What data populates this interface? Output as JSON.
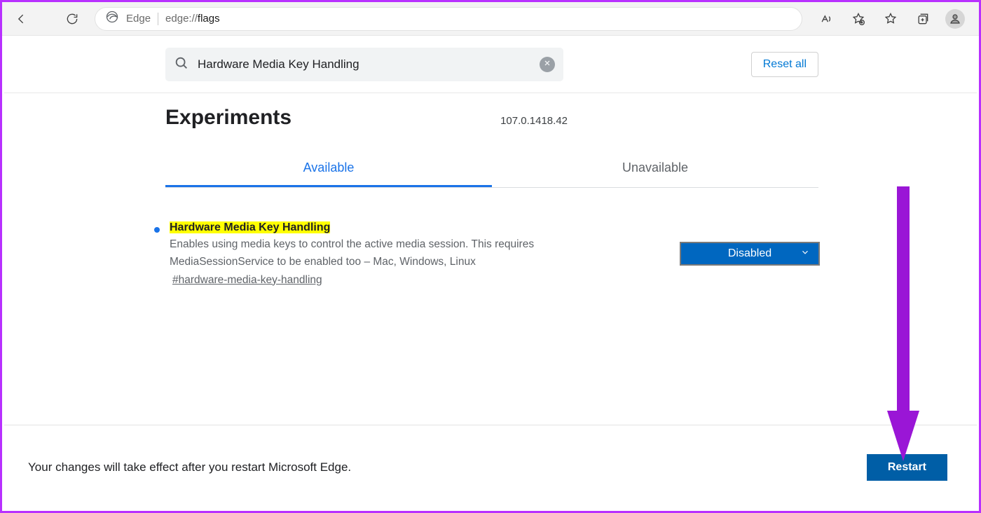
{
  "toolbar": {
    "browser_label": "Edge",
    "url_prefix": "edge://",
    "url_suffix": "flags"
  },
  "search": {
    "value": "Hardware Media Key Handling",
    "reset_label": "Reset all"
  },
  "header": {
    "title": "Experiments",
    "version": "107.0.1418.42"
  },
  "tabs": {
    "available": "Available",
    "unavailable": "Unavailable"
  },
  "flag": {
    "title": "Hardware Media Key Handling",
    "description": "Enables using media keys to control the active media session. This requires MediaSessionService to be enabled too – Mac, Windows, Linux",
    "hash": "#hardware-media-key-handling",
    "select_value": "Disabled"
  },
  "footer": {
    "message": "Your changes will take effect after you restart Microsoft Edge.",
    "restart_label": "Restart"
  }
}
